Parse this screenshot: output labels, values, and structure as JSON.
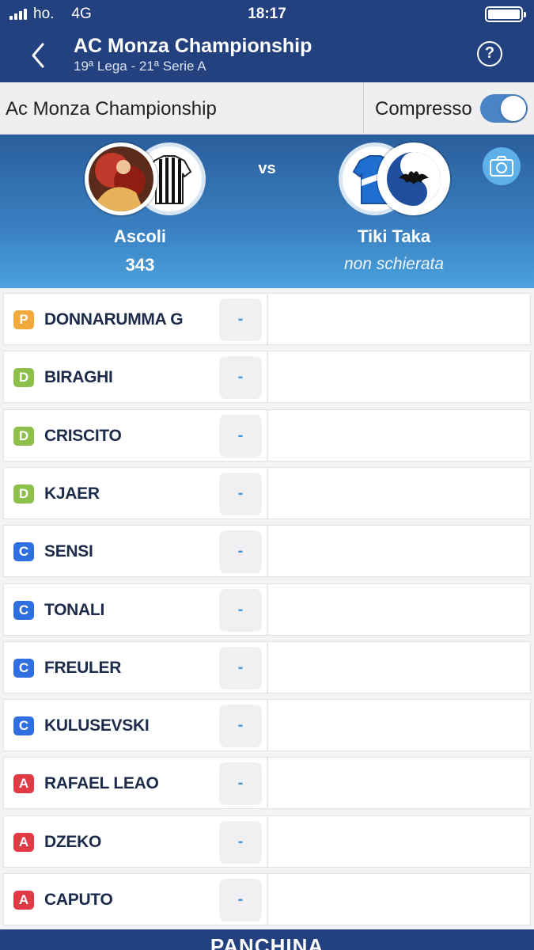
{
  "status_bar": {
    "carrier": "ho.",
    "network": "4G",
    "time": "18:17"
  },
  "nav": {
    "title": "AC Monza Championship",
    "subtitle": "19ª Lega - 21ª Serie A",
    "help_label": "?"
  },
  "filter": {
    "league_name": "Ac Monza Championship",
    "compresso_label": "Compresso",
    "compresso_on": true
  },
  "match": {
    "vs_label": "vs",
    "home": {
      "name": "Ascoli",
      "score": "343"
    },
    "away": {
      "name": "Tiki Taka",
      "status": "non schierata"
    }
  },
  "players": [
    {
      "role": "P",
      "name": "DONNARUMMA G",
      "score": "-"
    },
    {
      "role": "D",
      "name": "BIRAGHI",
      "score": "-"
    },
    {
      "role": "D",
      "name": "CRISCITO",
      "score": "-"
    },
    {
      "role": "D",
      "name": "KJAER",
      "score": "-"
    },
    {
      "role": "C",
      "name": "SENSI",
      "score": "-"
    },
    {
      "role": "C",
      "name": "TONALI",
      "score": "-"
    },
    {
      "role": "C",
      "name": "FREULER",
      "score": "-"
    },
    {
      "role": "C",
      "name": "KULUSEVSKI",
      "score": "-"
    },
    {
      "role": "A",
      "name": "RAFAEL LEAO",
      "score": "-"
    },
    {
      "role": "A",
      "name": "DZEKO",
      "score": "-"
    },
    {
      "role": "A",
      "name": "CAPUTO",
      "score": "-"
    }
  ],
  "role_colors": {
    "P": "#f2a93b",
    "D": "#8cc04a",
    "C": "#2f6fe0",
    "A": "#e03a45"
  },
  "bench_label": "PANCHINA"
}
